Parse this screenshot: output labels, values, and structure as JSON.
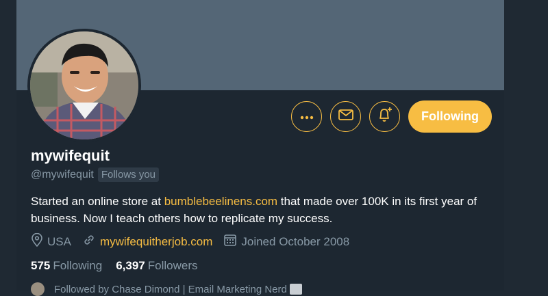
{
  "profile": {
    "name": "mywifequit",
    "handle": "@mywifequit",
    "follows_you": "Follows you",
    "bio_prefix": "Started an online store at ",
    "bio_link": "bumblebeelinens.com",
    "bio_suffix": " that made over 100K in its first year of business.  Now I teach others how to replicate my success.",
    "location": "USA",
    "website": "mywifequitherjob.com",
    "joined": "Joined October 2008",
    "following_count": "575",
    "following_label": "Following",
    "followers_count": "6,397",
    "followers_label": "Followers",
    "followed_by": "Followed by Chase Dimond | Email Marketing Nerd"
  },
  "actions": {
    "more_icon": "more-icon",
    "message_icon": "envelope-icon",
    "notify_icon": "bell-plus-icon",
    "following_button": "Following"
  },
  "colors": {
    "accent": "#f7bd43",
    "background": "#1d2731",
    "banner": "#546676",
    "muted": "#8899a6"
  }
}
